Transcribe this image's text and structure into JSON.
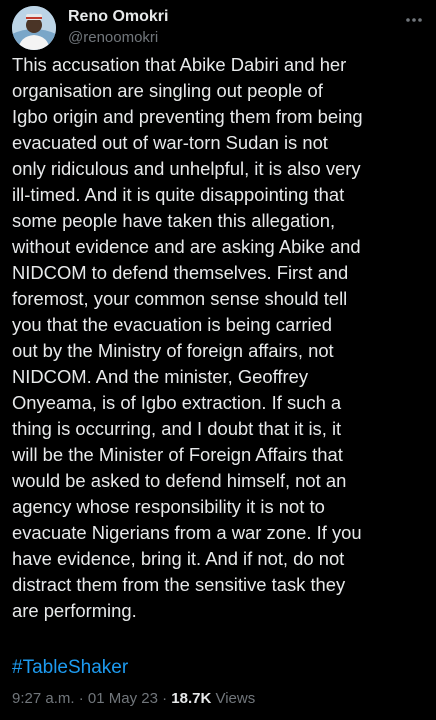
{
  "author": {
    "name": "Reno Omokri",
    "handle": "@renoomokri"
  },
  "tweet": {
    "text": "This accusation that Abike Dabiri and her\norganisation are singling out people of\nIgbo origin and preventing them from being\nevacuated out of war-torn Sudan is not\nonly ridiculous and unhelpful, it is also very\nill-timed. And it is quite disappointing that\nsome people have taken this allegation,\nwithout evidence and are asking Abike and\nNIDCOM to defend themselves. First and\nforemost, your common sense should tell\nyou that the evacuation is being carried\nout by the Ministry of foreign affairs, not\nNIDCOM. And the minister, Geoffrey\nOnyeama, is of Igbo extraction. If such a\nthing is occurring, and I doubt that it is, it\nwill be the Minister of Foreign Affairs that\nwould be asked to defend himself, not an\nagency whose responsibility it is not to\nevacuate Nigerians from a war zone. If you\nhave evidence, bring it. And if not, do not\ndistract them from the sensitive task they\nare performing.",
    "hashtag": "#TableShaker"
  },
  "meta": {
    "time": "9:27 a.m.",
    "separator": "·",
    "date": "01 May 23",
    "views_count": "18.7K",
    "views_label": "Views"
  },
  "icons": {
    "more": "more-options-icon"
  },
  "colors": {
    "background": "#000000",
    "text": "#e7e9ea",
    "secondary": "#71767b",
    "link": "#1d9bf0"
  }
}
